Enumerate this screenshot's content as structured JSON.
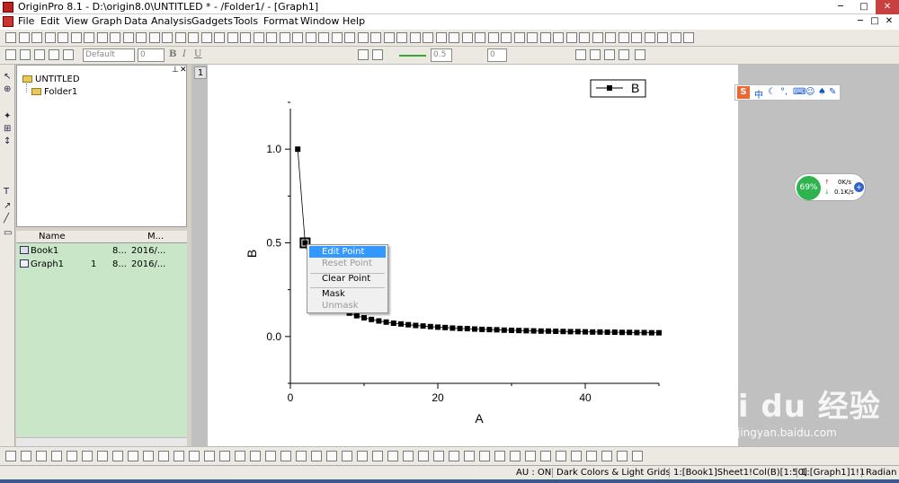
{
  "window": {
    "title": "OriginPro 8.1 - D:\\origin8.0\\UNTITLED * - /Folder1/ - [Graph1]",
    "min_glyph": "─",
    "max_glyph": "□",
    "close_glyph": "✕"
  },
  "menu": [
    "File",
    "Edit",
    "View",
    "Graph",
    "Data",
    "Analysis",
    "Gadgets",
    "Tools",
    "Format",
    "Window",
    "Help"
  ],
  "toolbar2": {
    "font_value": "Default",
    "size_value": "0",
    "line_width": "0.5",
    "pattern_value": "0",
    "bold": "B",
    "italic": "I",
    "underline": "U"
  },
  "project_explorer": {
    "root": "UNTITLED",
    "folder": "Folder1",
    "columns": [
      "Name",
      "M..."
    ],
    "items": [
      {
        "name": "Book1",
        "num": "",
        "col3": "8...",
        "date": "2016/..."
      },
      {
        "name": "Graph1",
        "num": "1",
        "col3": "8...",
        "date": "2016/..."
      }
    ]
  },
  "graph": {
    "tab": "1",
    "legend_label": "B"
  },
  "chart_data": {
    "type": "scatter",
    "title": "",
    "xlabel": "A",
    "ylabel": "B",
    "xlim": [
      0,
      50
    ],
    "ylim": [
      -0.25,
      1.25
    ],
    "xticks": [
      "0",
      "20",
      "40"
    ],
    "yticks": [
      "0.0",
      "0.5",
      "1.0"
    ],
    "series": [
      {
        "name": "B",
        "x": [
          1,
          2,
          3,
          4,
          5,
          6,
          7,
          8,
          9,
          10,
          11,
          12,
          13,
          14,
          15,
          16,
          17,
          18,
          19,
          20,
          21,
          22,
          23,
          24,
          25,
          26,
          27,
          28,
          29,
          30,
          31,
          32,
          33,
          34,
          35,
          36,
          37,
          38,
          39,
          40,
          41,
          42,
          43,
          44,
          45,
          46,
          47,
          48,
          49,
          50
        ],
        "y": [
          1.0,
          0.5,
          0.333,
          0.25,
          0.2,
          0.167,
          0.143,
          0.125,
          0.111,
          0.1,
          0.091,
          0.083,
          0.077,
          0.071,
          0.067,
          0.063,
          0.059,
          0.056,
          0.053,
          0.05,
          0.048,
          0.045,
          0.043,
          0.042,
          0.04,
          0.038,
          0.037,
          0.036,
          0.034,
          0.033,
          0.032,
          0.031,
          0.03,
          0.029,
          0.029,
          0.028,
          0.027,
          0.026,
          0.026,
          0.025,
          0.024,
          0.024,
          0.023,
          0.023,
          0.022,
          0.022,
          0.021,
          0.021,
          0.02,
          0.02
        ]
      }
    ],
    "legend": "top-right",
    "grid": false
  },
  "context_menu": [
    {
      "label": "Edit Point",
      "enabled": true,
      "highlight": true
    },
    {
      "label": "Reset Point",
      "enabled": false
    },
    {
      "label": "Clear Point",
      "enabled": true
    },
    {
      "label": "Mask",
      "enabled": true
    },
    {
      "label": "Unmask",
      "enabled": false
    }
  ],
  "ime": {
    "label": "中"
  },
  "net_widget": {
    "percent": "69%",
    "up": "0K/s",
    "down": "0.1K/s"
  },
  "status": {
    "au": "AU : ON",
    "theme": "Dark Colors & Light Grids",
    "sel": "1:[Book1]Sheet1!Col(B)[1:50]",
    "layer": "1:[Graph1]1!1",
    "unit": "Radian"
  },
  "watermark": {
    "main": "Bai du 经验",
    "sub": "jingyan.baidu.com"
  },
  "colors": {
    "highlight": "#3399ff",
    "explorer_bg": "#c9e6c9",
    "accent": "#b22222"
  }
}
